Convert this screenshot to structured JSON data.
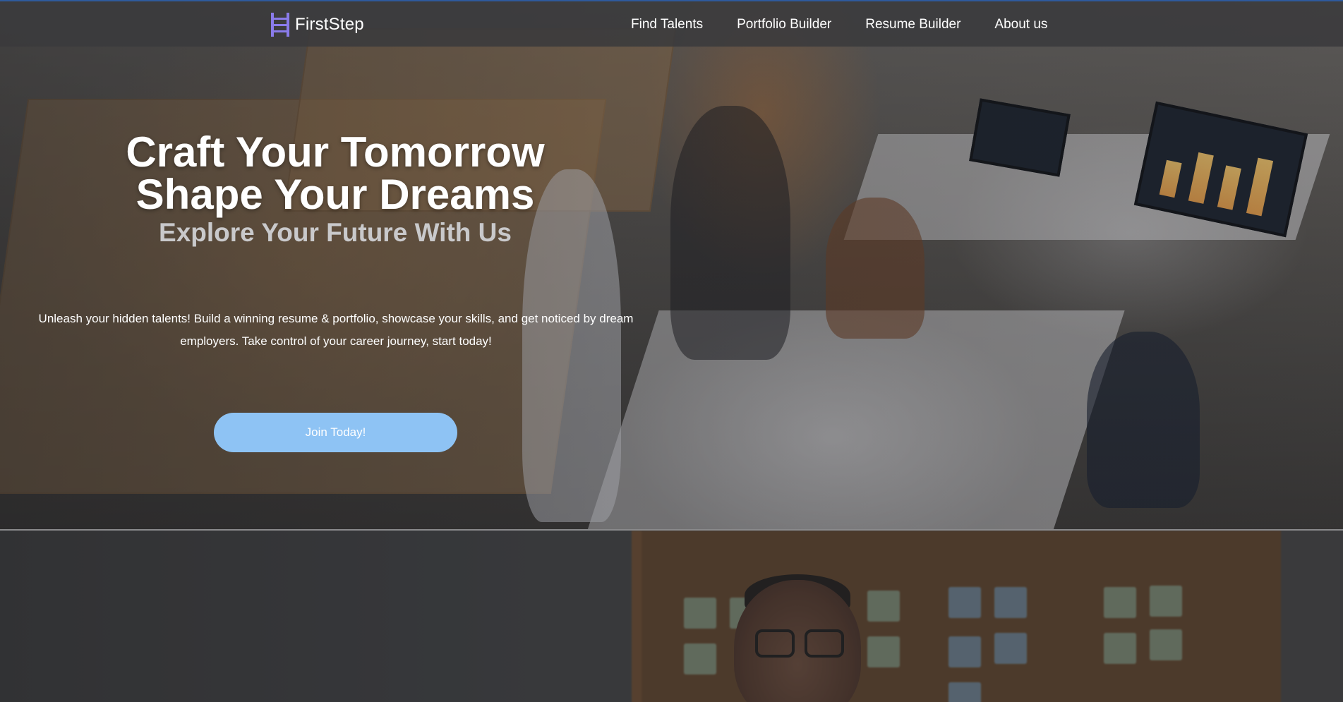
{
  "nav": {
    "brand": "FirstStep",
    "logo_icon": "ladder-logo-icon",
    "links": [
      "Find Talents",
      "Portfolio Builder",
      "Resume Builder",
      "About us"
    ]
  },
  "hero": {
    "title_line1": "Craft Your Tomorrow",
    "title_line2": "Shape Your Dreams",
    "subtitle": "Explore Your Future With Us",
    "description": "Unleash your hidden talents! Build a winning resume & portfolio, showcase your skills, and get noticed by dream employers. Take control of your career journey, start today!",
    "cta_label": "Join Today!"
  },
  "colors": {
    "navbar_bg": "#3a3a3c",
    "cta_bg": "#8ec3f4",
    "logo_accent": "#8a7bea",
    "subtitle_text": "#c9c9cb"
  }
}
